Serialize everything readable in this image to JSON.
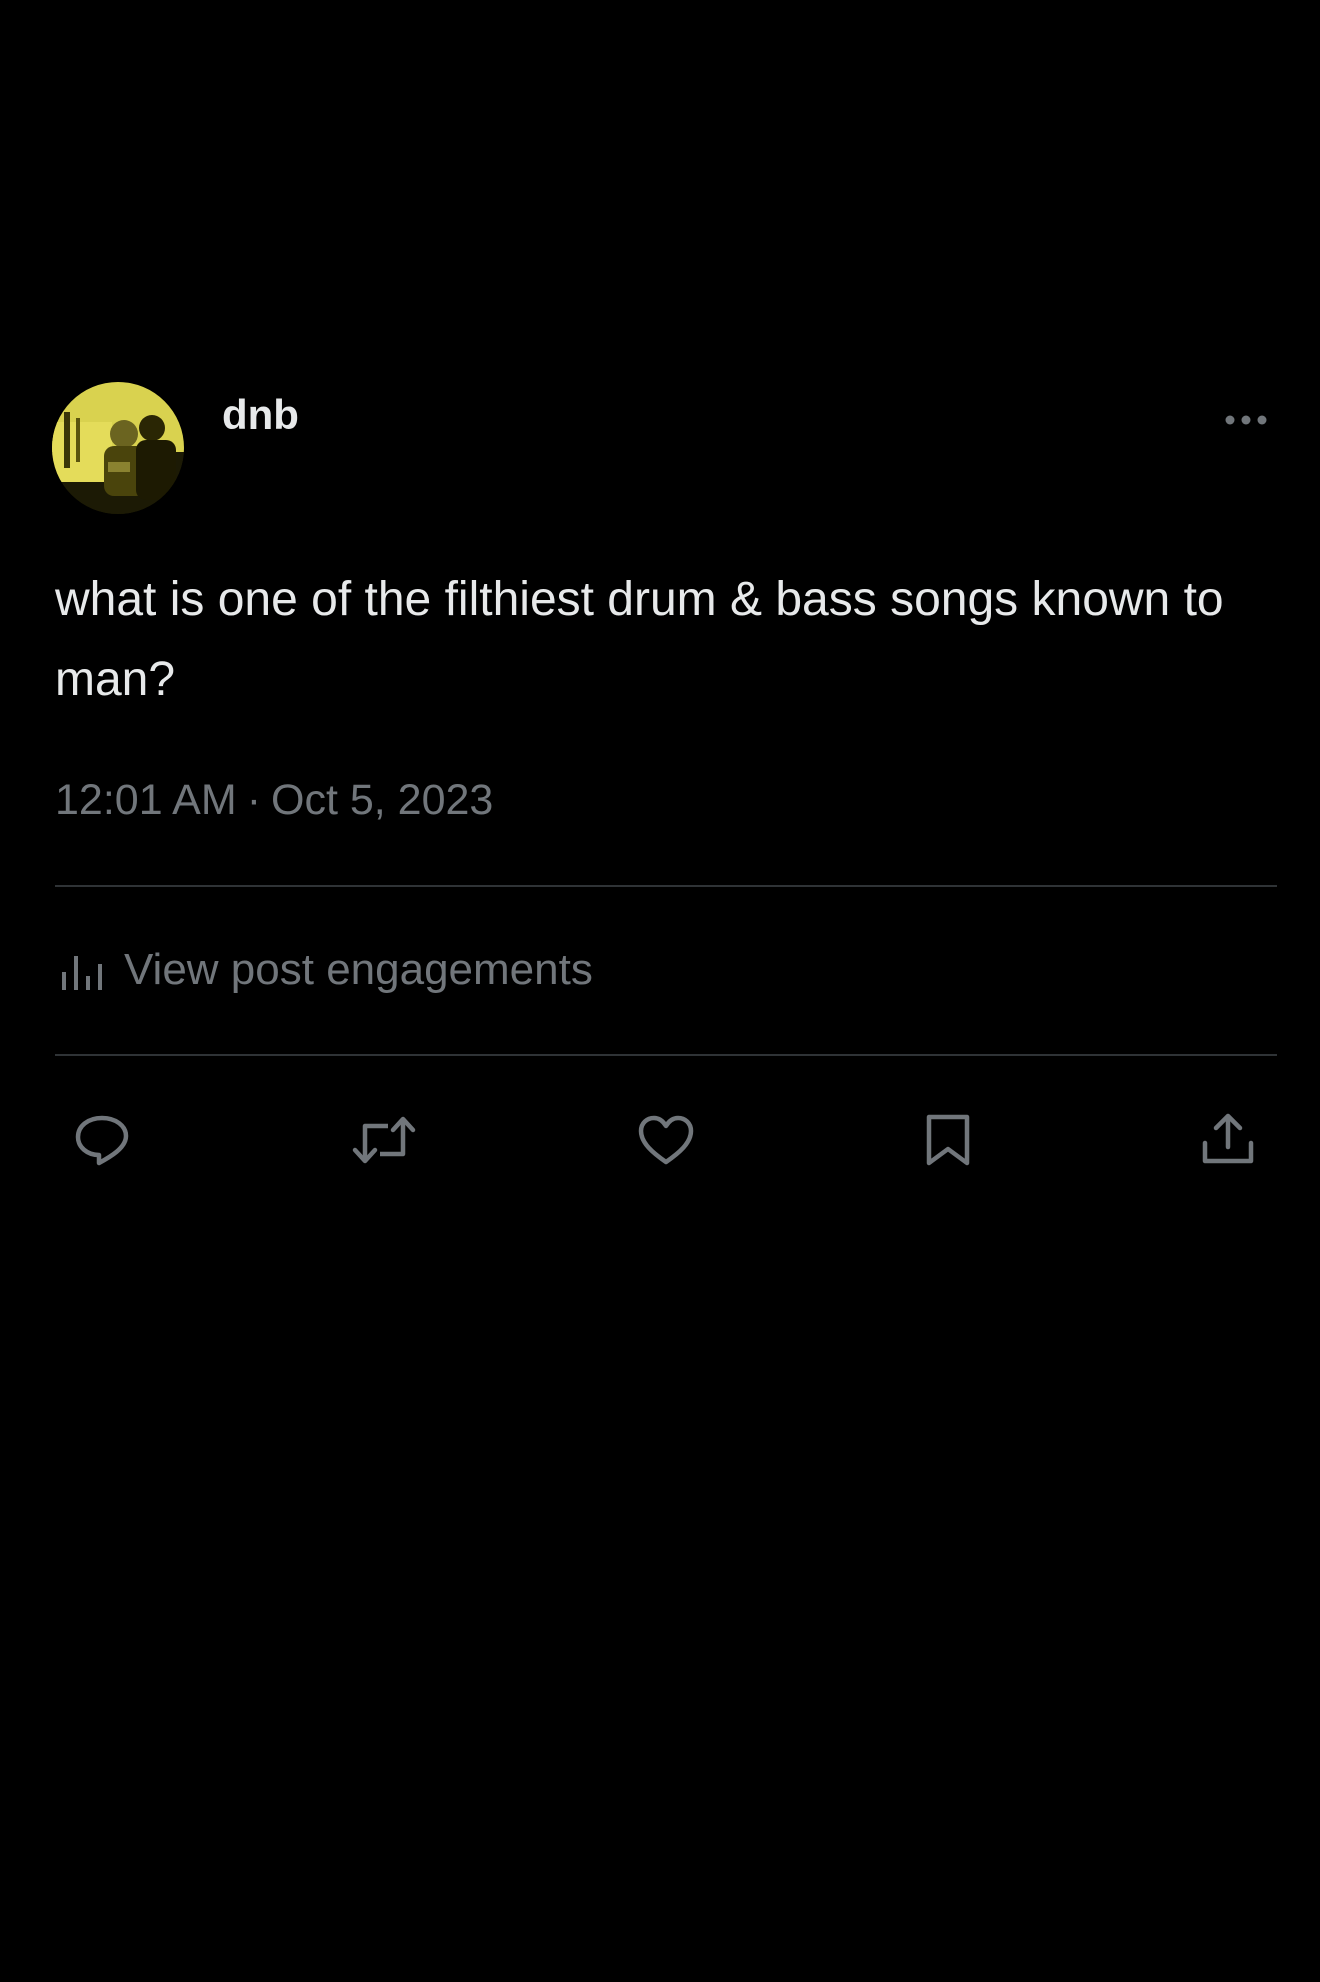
{
  "post": {
    "author": {
      "display_name": "dnb",
      "avatar": "profile-photo"
    },
    "more_icon": "more-horizontal-icon",
    "text": "what is one of the filthiest drum & bass songs known to man?",
    "time": "12:01 AM",
    "separator": "·",
    "date": "Oct 5, 2023",
    "engagements": {
      "icon": "analytics-icon",
      "label": "View post engagements"
    },
    "actions": [
      {
        "name": "reply",
        "icon": "reply-icon"
      },
      {
        "name": "repost",
        "icon": "repost-icon"
      },
      {
        "name": "like",
        "icon": "heart-icon"
      },
      {
        "name": "bookmark",
        "icon": "bookmark-icon"
      },
      {
        "name": "share",
        "icon": "share-icon"
      }
    ]
  },
  "colors": {
    "background": "#000000",
    "primary_text": "#e7e9ea",
    "secondary_text": "#71767b",
    "divider": "#2f3336",
    "avatar_accent": "#e4dc5a"
  }
}
